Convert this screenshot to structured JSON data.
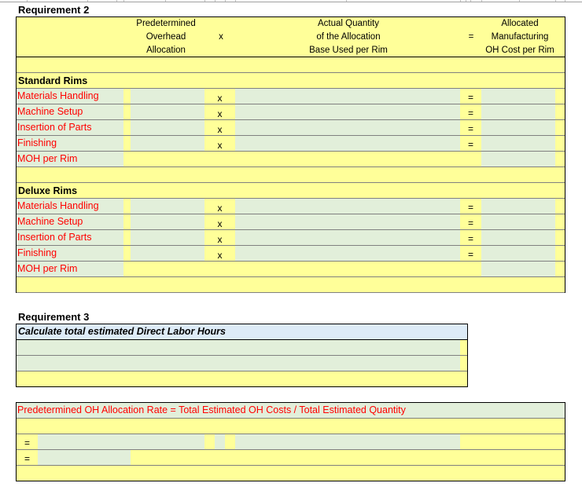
{
  "requirement2": {
    "title": "Requirement 2",
    "header": {
      "col1": [
        "Predetermined",
        "Overhead",
        "Allocation"
      ],
      "times_op": "x",
      "col2": [
        "Actual Quantity",
        "of the Allocation",
        "Base Used per Rim"
      ],
      "equals_op": "=",
      "col3": [
        "Allocated",
        "Manufacturing",
        "OH Cost per Rim"
      ]
    },
    "sections": [
      {
        "title": "Standard Rims",
        "rows": [
          {
            "label": "Materials Handling",
            "rate": "",
            "quantity": "",
            "cost": ""
          },
          {
            "label": "Machine Setup",
            "rate": "",
            "quantity": "",
            "cost": ""
          },
          {
            "label": "Insertion of Parts",
            "rate": "",
            "quantity": "",
            "cost": ""
          },
          {
            "label": "Finishing",
            "rate": "",
            "quantity": "",
            "cost": ""
          }
        ],
        "total_label": "MOH per Rim",
        "total_value": ""
      },
      {
        "title": "Deluxe Rims",
        "rows": [
          {
            "label": "Materials Handling",
            "rate": "",
            "quantity": "",
            "cost": ""
          },
          {
            "label": "Machine Setup",
            "rate": "",
            "quantity": "",
            "cost": ""
          },
          {
            "label": "Insertion of Parts",
            "rate": "",
            "quantity": "",
            "cost": ""
          },
          {
            "label": "Finishing",
            "rate": "",
            "quantity": "",
            "cost": ""
          }
        ],
        "total_label": "MOH per Rim",
        "total_value": ""
      }
    ],
    "times_op": "x",
    "equals_op": "="
  },
  "requirement3": {
    "title": "Requirement 3",
    "subtitle": "Calculate total estimated Direct Labor Hours",
    "inputs": [
      "",
      ""
    ],
    "formula": "Predetermined OH Allocation Rate = Total Estimated OH Costs / Total Estimated Quantity",
    "equals_op": "=",
    "calc_row1": [
      "",
      "",
      ""
    ],
    "calc_row2": [
      ""
    ]
  },
  "colors": {
    "yellow": "#ffff99",
    "green_input": "#e2efda",
    "blue_header": "#ddebf7",
    "label_red": "#ff0000"
  }
}
